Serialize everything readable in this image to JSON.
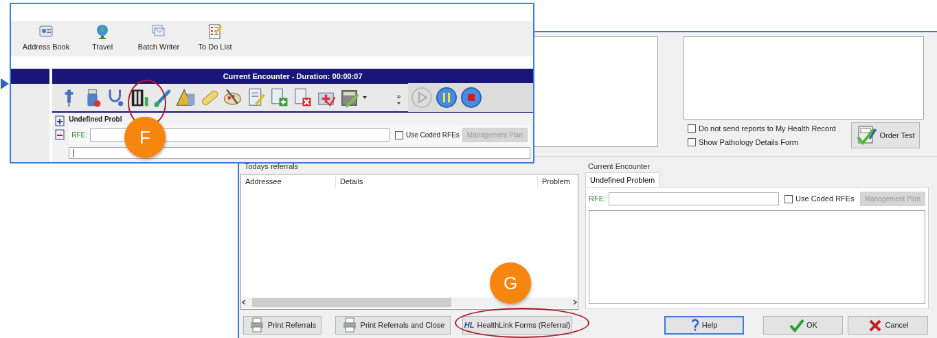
{
  "zoom_panel": {
    "quick_launch": [
      {
        "label": "Address Book"
      },
      {
        "label": "Travel"
      },
      {
        "label": "Batch Writer"
      },
      {
        "label": "To Do List"
      }
    ],
    "encounter_title": "Current Encounter - Duration: 00:00:07",
    "overflow_glyph": "»",
    "problem_title": "Undefined Probl",
    "rfe_label": "RFE:",
    "use_coded_rfes": {
      "label": "Use Coded RFEs",
      "checked": false
    },
    "management_plan": {
      "label": "Management Plan",
      "disabled": true
    },
    "note_value": "|"
  },
  "referral_window": {
    "options": [
      {
        "label": "Do not send reports to My Health Record",
        "checked": false
      },
      {
        "label": "Show Pathology Details Form",
        "checked": false
      }
    ],
    "order_test": "Order Test",
    "referrals": {
      "title": "Todays referrals",
      "columns": [
        "Addressee",
        "Details",
        "Problem"
      ]
    },
    "encounter": {
      "title": "Current Encounter",
      "tabs": [
        {
          "label": "Undefined Problem",
          "selected": true
        }
      ],
      "rfe_label": "RFE:",
      "use_coded_rfes": {
        "label": "Use Coded RFEs",
        "checked": false
      },
      "management_plan": {
        "label": "Management Plan",
        "disabled": true
      }
    },
    "buttons": [
      {
        "label": "Print Referrals",
        "kind": "print",
        "default": false
      },
      {
        "label": "Print Referrals and Close",
        "kind": "print",
        "default": false
      },
      {
        "label": "HealthLink Forms (Referral)",
        "kind": "healthlink",
        "logo": "HL",
        "default": false
      },
      {
        "label": "Help",
        "kind": "help",
        "default": true
      },
      {
        "label": "OK",
        "kind": "ok",
        "default": false
      },
      {
        "label": "Cancel",
        "kind": "cancel",
        "default": false
      }
    ]
  },
  "callouts": [
    {
      "label": "F"
    },
    {
      "label": "G"
    }
  ]
}
